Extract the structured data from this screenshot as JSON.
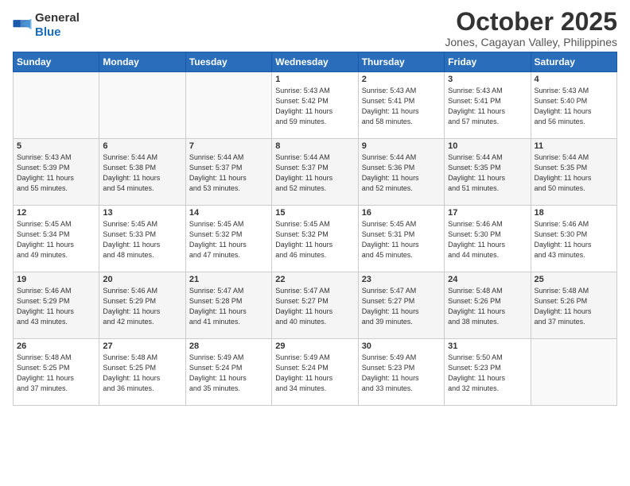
{
  "logo": {
    "general": "General",
    "blue": "Blue"
  },
  "title": "October 2025",
  "subtitle": "Jones, Cagayan Valley, Philippines",
  "headers": [
    "Sunday",
    "Monday",
    "Tuesday",
    "Wednesday",
    "Thursday",
    "Friday",
    "Saturday"
  ],
  "weeks": [
    [
      {
        "day": "",
        "info": ""
      },
      {
        "day": "",
        "info": ""
      },
      {
        "day": "",
        "info": ""
      },
      {
        "day": "1",
        "info": "Sunrise: 5:43 AM\nSunset: 5:42 PM\nDaylight: 11 hours\nand 59 minutes."
      },
      {
        "day": "2",
        "info": "Sunrise: 5:43 AM\nSunset: 5:41 PM\nDaylight: 11 hours\nand 58 minutes."
      },
      {
        "day": "3",
        "info": "Sunrise: 5:43 AM\nSunset: 5:41 PM\nDaylight: 11 hours\nand 57 minutes."
      },
      {
        "day": "4",
        "info": "Sunrise: 5:43 AM\nSunset: 5:40 PM\nDaylight: 11 hours\nand 56 minutes."
      }
    ],
    [
      {
        "day": "5",
        "info": "Sunrise: 5:43 AM\nSunset: 5:39 PM\nDaylight: 11 hours\nand 55 minutes."
      },
      {
        "day": "6",
        "info": "Sunrise: 5:44 AM\nSunset: 5:38 PM\nDaylight: 11 hours\nand 54 minutes."
      },
      {
        "day": "7",
        "info": "Sunrise: 5:44 AM\nSunset: 5:37 PM\nDaylight: 11 hours\nand 53 minutes."
      },
      {
        "day": "8",
        "info": "Sunrise: 5:44 AM\nSunset: 5:37 PM\nDaylight: 11 hours\nand 52 minutes."
      },
      {
        "day": "9",
        "info": "Sunrise: 5:44 AM\nSunset: 5:36 PM\nDaylight: 11 hours\nand 52 minutes."
      },
      {
        "day": "10",
        "info": "Sunrise: 5:44 AM\nSunset: 5:35 PM\nDaylight: 11 hours\nand 51 minutes."
      },
      {
        "day": "11",
        "info": "Sunrise: 5:44 AM\nSunset: 5:35 PM\nDaylight: 11 hours\nand 50 minutes."
      }
    ],
    [
      {
        "day": "12",
        "info": "Sunrise: 5:45 AM\nSunset: 5:34 PM\nDaylight: 11 hours\nand 49 minutes."
      },
      {
        "day": "13",
        "info": "Sunrise: 5:45 AM\nSunset: 5:33 PM\nDaylight: 11 hours\nand 48 minutes."
      },
      {
        "day": "14",
        "info": "Sunrise: 5:45 AM\nSunset: 5:32 PM\nDaylight: 11 hours\nand 47 minutes."
      },
      {
        "day": "15",
        "info": "Sunrise: 5:45 AM\nSunset: 5:32 PM\nDaylight: 11 hours\nand 46 minutes."
      },
      {
        "day": "16",
        "info": "Sunrise: 5:45 AM\nSunset: 5:31 PM\nDaylight: 11 hours\nand 45 minutes."
      },
      {
        "day": "17",
        "info": "Sunrise: 5:46 AM\nSunset: 5:30 PM\nDaylight: 11 hours\nand 44 minutes."
      },
      {
        "day": "18",
        "info": "Sunrise: 5:46 AM\nSunset: 5:30 PM\nDaylight: 11 hours\nand 43 minutes."
      }
    ],
    [
      {
        "day": "19",
        "info": "Sunrise: 5:46 AM\nSunset: 5:29 PM\nDaylight: 11 hours\nand 43 minutes."
      },
      {
        "day": "20",
        "info": "Sunrise: 5:46 AM\nSunset: 5:29 PM\nDaylight: 11 hours\nand 42 minutes."
      },
      {
        "day": "21",
        "info": "Sunrise: 5:47 AM\nSunset: 5:28 PM\nDaylight: 11 hours\nand 41 minutes."
      },
      {
        "day": "22",
        "info": "Sunrise: 5:47 AM\nSunset: 5:27 PM\nDaylight: 11 hours\nand 40 minutes."
      },
      {
        "day": "23",
        "info": "Sunrise: 5:47 AM\nSunset: 5:27 PM\nDaylight: 11 hours\nand 39 minutes."
      },
      {
        "day": "24",
        "info": "Sunrise: 5:48 AM\nSunset: 5:26 PM\nDaylight: 11 hours\nand 38 minutes."
      },
      {
        "day": "25",
        "info": "Sunrise: 5:48 AM\nSunset: 5:26 PM\nDaylight: 11 hours\nand 37 minutes."
      }
    ],
    [
      {
        "day": "26",
        "info": "Sunrise: 5:48 AM\nSunset: 5:25 PM\nDaylight: 11 hours\nand 37 minutes."
      },
      {
        "day": "27",
        "info": "Sunrise: 5:48 AM\nSunset: 5:25 PM\nDaylight: 11 hours\nand 36 minutes."
      },
      {
        "day": "28",
        "info": "Sunrise: 5:49 AM\nSunset: 5:24 PM\nDaylight: 11 hours\nand 35 minutes."
      },
      {
        "day": "29",
        "info": "Sunrise: 5:49 AM\nSunset: 5:24 PM\nDaylight: 11 hours\nand 34 minutes."
      },
      {
        "day": "30",
        "info": "Sunrise: 5:49 AM\nSunset: 5:23 PM\nDaylight: 11 hours\nand 33 minutes."
      },
      {
        "day": "31",
        "info": "Sunrise: 5:50 AM\nSunset: 5:23 PM\nDaylight: 11 hours\nand 32 minutes."
      },
      {
        "day": "",
        "info": ""
      }
    ]
  ]
}
